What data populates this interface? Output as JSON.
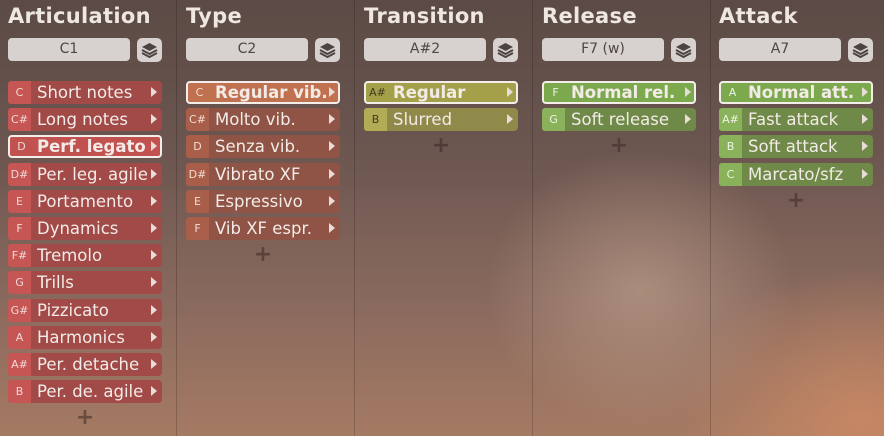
{
  "columns": [
    {
      "title": "Articulation",
      "key": "C1",
      "theme": "red",
      "items": [
        {
          "key": "C",
          "label": "Short notes"
        },
        {
          "key": "C#",
          "label": "Long notes"
        },
        {
          "key": "D",
          "label": "Perf. legato",
          "selected": true
        },
        {
          "key": "D#",
          "label": "Per. leg. agile"
        },
        {
          "key": "E",
          "label": "Portamento"
        },
        {
          "key": "F",
          "label": "Dynamics"
        },
        {
          "key": "F#",
          "label": "Tremolo"
        },
        {
          "key": "G",
          "label": "Trills"
        },
        {
          "key": "G#",
          "label": "Pizzicato"
        },
        {
          "key": "A",
          "label": "Harmonics"
        },
        {
          "key": "A#",
          "label": "Per. detache"
        },
        {
          "key": "B",
          "label": "Per. de. agile"
        }
      ]
    },
    {
      "title": "Type",
      "key": "C2",
      "theme": "orange",
      "items": [
        {
          "key": "C",
          "label": "Regular vib.",
          "selected": true
        },
        {
          "key": "C#",
          "label": "Molto vib."
        },
        {
          "key": "D",
          "label": "Senza vib."
        },
        {
          "key": "D#",
          "label": "Vibrato XF"
        },
        {
          "key": "E",
          "label": "Espressivo"
        },
        {
          "key": "F",
          "label": "Vib XF espr."
        }
      ]
    },
    {
      "title": "Transition",
      "key": "A#2",
      "theme": "olive",
      "items": [
        {
          "key": "A#",
          "label": "Regular",
          "selected": true
        },
        {
          "key": "B",
          "label": "Slurred"
        }
      ]
    },
    {
      "title": "Release",
      "key": "F7 (w)",
      "theme": "green",
      "items": [
        {
          "key": "F",
          "label": "Normal rel.",
          "selected": true
        },
        {
          "key": "G",
          "label": "Soft release"
        }
      ]
    },
    {
      "title": "Attack",
      "key": "A7",
      "theme": "green",
      "items": [
        {
          "key": "A",
          "label": "Normal att.",
          "selected": true
        },
        {
          "key": "A#",
          "label": "Fast attack"
        },
        {
          "key": "B",
          "label": "Soft attack"
        },
        {
          "key": "C",
          "label": "Marcato/sfz"
        }
      ]
    }
  ],
  "add_symbol": "+",
  "icons": {
    "layer": "layers-icon",
    "arrow": "chevron-right-icon",
    "add": "plus-icon"
  }
}
